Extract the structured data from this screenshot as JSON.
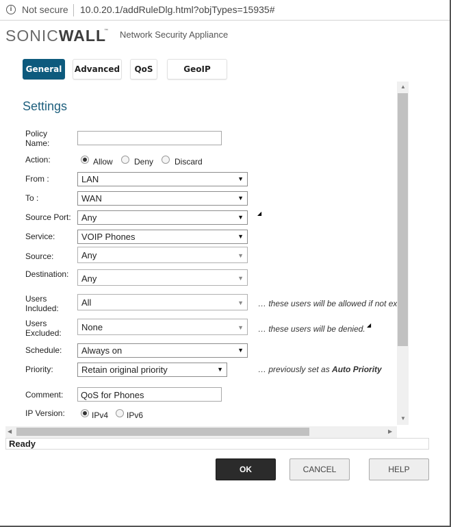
{
  "browser": {
    "security_label": "Not secure",
    "url": "10.0.20.1/addRuleDlg.html?objTypes=15935#",
    "info_icon": "info-icon"
  },
  "header": {
    "logo_part1": "SONIC",
    "logo_part2": "WALL",
    "subtitle": "Network Security Appliance"
  },
  "tabs": [
    {
      "label": "General",
      "active": true
    },
    {
      "label": "Advanced",
      "active": false
    },
    {
      "label": "QoS",
      "active": false
    },
    {
      "label": "GeoIP",
      "active": false
    }
  ],
  "settings": {
    "title": "Settings",
    "policy_name": {
      "label": "Policy Name:",
      "value": ""
    },
    "action": {
      "label": "Action:",
      "options": [
        "Allow",
        "Deny",
        "Discard"
      ],
      "selected": "Allow"
    },
    "from": {
      "label": "From :",
      "value": "LAN"
    },
    "to": {
      "label": "To :",
      "value": "WAN"
    },
    "source_port": {
      "label": "Source Port:",
      "value": "Any"
    },
    "service": {
      "label": "Service:",
      "value": "VOIP Phones"
    },
    "source": {
      "label": "Source:",
      "value": "Any"
    },
    "destination": {
      "label": "Destination:",
      "value": "Any"
    },
    "users_included": {
      "label": "Users Included:",
      "value": "All",
      "note": "… these users will be allowed if not ex"
    },
    "users_excluded": {
      "label": "Users Excluded:",
      "value": "None",
      "note": "… these users will be denied."
    },
    "schedule": {
      "label": "Schedule:",
      "value": "Always on"
    },
    "priority": {
      "label": "Priority:",
      "value": "Retain original priority",
      "note_prefix": "… previously set as ",
      "note_value": "Auto Priority"
    },
    "comment": {
      "label": "Comment:",
      "value": "QoS for Phones"
    },
    "ip_version": {
      "label": "IP Version:",
      "options": [
        "IPv4",
        "IPv6"
      ],
      "selected": "IPv4"
    }
  },
  "status_bar": {
    "text": "Ready"
  },
  "buttons": {
    "ok": "OK",
    "cancel": "CANCEL",
    "help": "HELP"
  },
  "colors": {
    "accent": "#0d5a7d",
    "title": "#1e5f7d",
    "ok_button": "#2b2b2b"
  }
}
